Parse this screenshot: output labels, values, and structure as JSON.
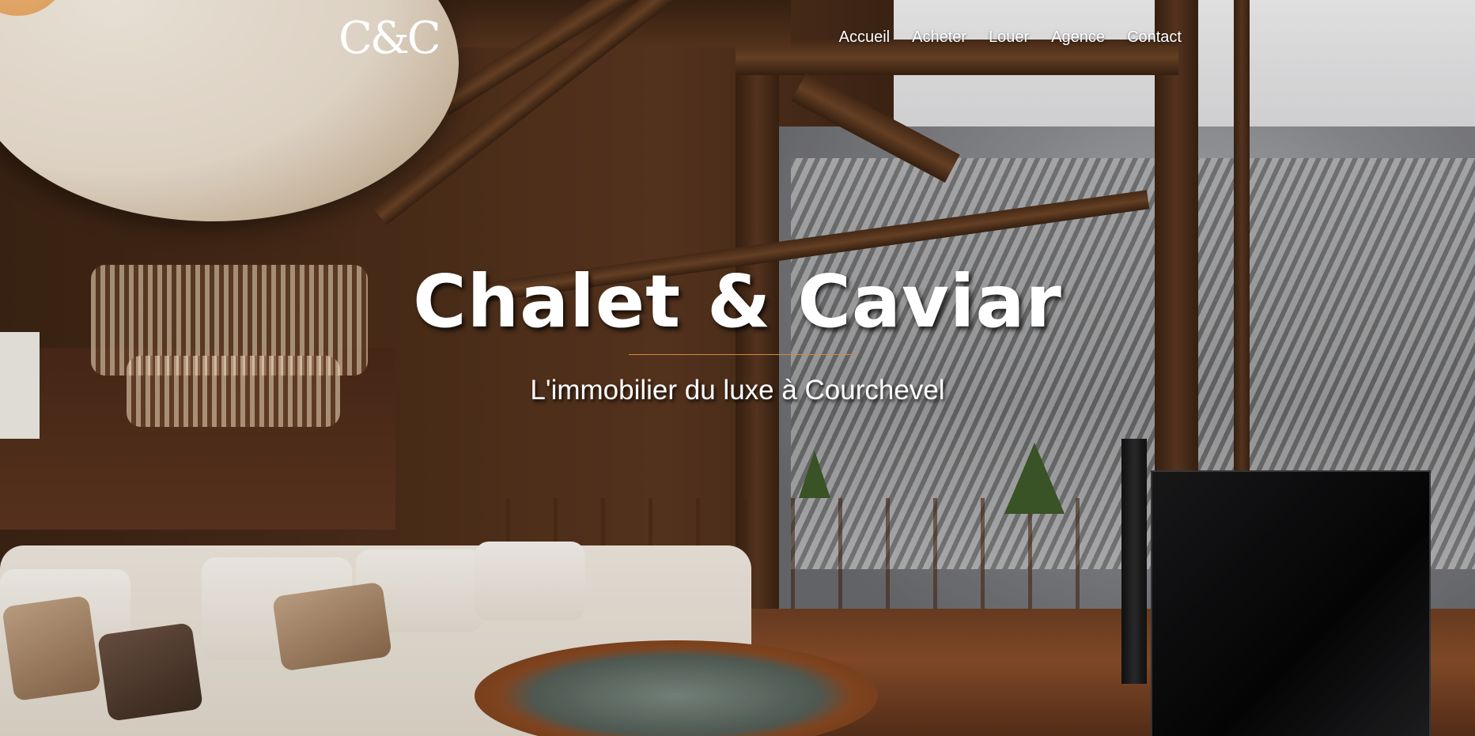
{
  "brand": {
    "logo_text": "C&C"
  },
  "nav": {
    "items": [
      {
        "label": "Accueil"
      },
      {
        "label": "Acheter"
      },
      {
        "label": "Louer"
      },
      {
        "label": "Agence"
      },
      {
        "label": "Contact"
      }
    ]
  },
  "hero": {
    "title": "Chalet & Caviar",
    "subtitle": "L'immobilier du luxe à Courchevel",
    "divider_color": "#d18a3c"
  }
}
